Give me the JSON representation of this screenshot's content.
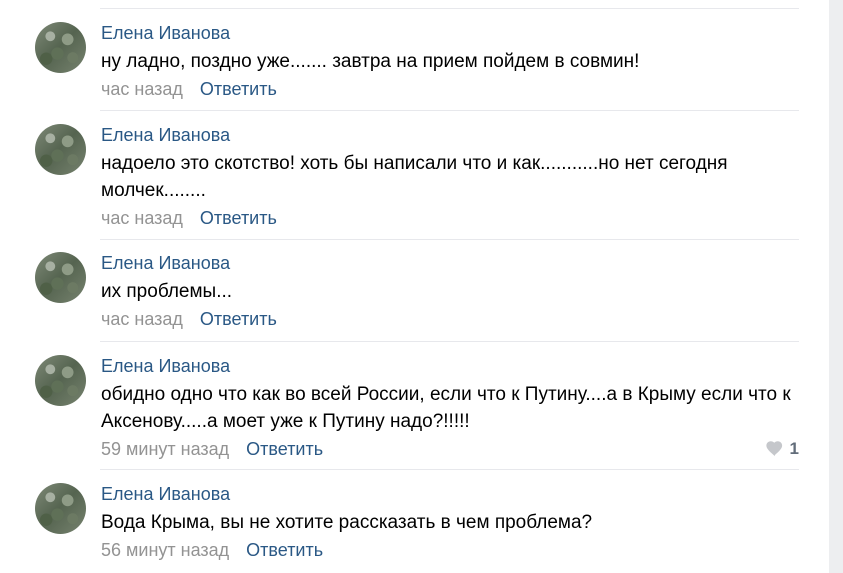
{
  "comments": [
    {
      "author": "Елена Иванова",
      "text": "ну ладно, поздно уже....... завтра на прием пойдем в совмин!",
      "time": "час назад",
      "reply": "Ответить"
    },
    {
      "author": "Елена Иванова",
      "text": "надоело это скотство! хоть бы написали что и как...........но нет сегодня молчек........",
      "time": "час назад",
      "reply": "Ответить"
    },
    {
      "author": "Елена Иванова",
      "text": "их проблемы...",
      "time": "час назад",
      "reply": "Ответить"
    },
    {
      "author": "Елена Иванова",
      "text": "обидно одно что как во всей России, если что к Путину....а в Крыму если что к Аксенову.....а моет уже к Путину надо?!!!!!",
      "time": "59 минут назад",
      "reply": "Ответить",
      "likes": "1"
    },
    {
      "author": "Елена Иванова",
      "text": "Вода Крыма, вы не хотите рассказать в чем проблема?",
      "time": "56 минут назад",
      "reply": "Ответить"
    }
  ],
  "icons": {
    "like": "heart-icon",
    "avatar": "user-avatar"
  },
  "colors": {
    "author": "#2a5885",
    "meta": "#939393",
    "divider": "#e7e8ec",
    "background": "#edeef0"
  }
}
